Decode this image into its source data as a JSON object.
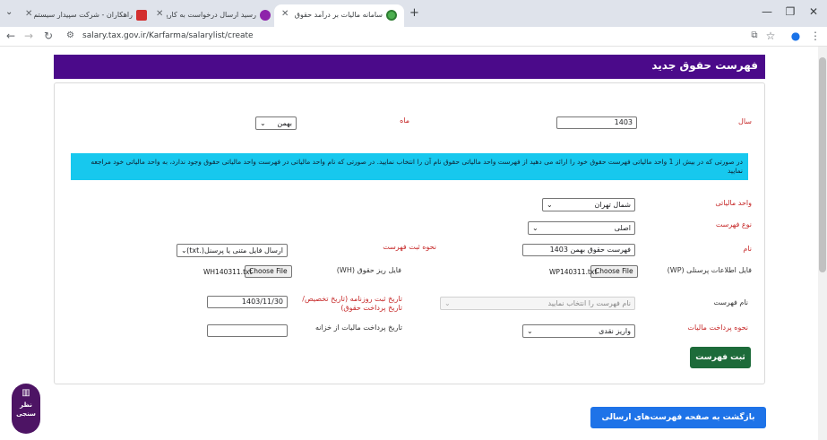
{
  "browser": {
    "tabs": [
      {
        "label": "راهکاران - شرکت سپیدار سیستم آ...",
        "active": false
      },
      {
        "label": "رسید ارسال درخواست به کارپوشه",
        "active": false
      },
      {
        "label": "سامانه مالیات بر درآمد حقوق",
        "active": true
      }
    ],
    "new_tab": "+",
    "url": "salary.tax.gov.ir/Karfarma/salarylist/create",
    "window_controls": {
      "minimize": "—",
      "restore": "❐",
      "close": "✕"
    }
  },
  "page": {
    "title": "فهرست حقوق جدید",
    "form": {
      "year_label": "سال",
      "year_value": "1403",
      "month_label": "ماه",
      "month_value": "بهمن",
      "info_text": "در صورتی که در بیش از 1 واحد مالیاتی فهرست حقوق خود را ارائه می دهید از فهرست واحد مالیاتی حقوق نام آن را انتخاب نمایید. در صورتی که نام واحد مالیاتی در فهرست واحد مالیاتی حقوق وجود ندارد، به واحد مالیاتی خود مراجعه نمایید",
      "tax_unit_label": "واحد مالیاتی",
      "tax_unit_value": "شمال تهران",
      "list_type_label": "نوع فهرست",
      "list_type_value": "اصلی",
      "name_label": "نام",
      "name_value": "فهرست حقوق بهمن 1403",
      "submit_method_label": "نحوه ثبت فهرست",
      "submit_method_value": "ارسال فایل متنی یا پرسنل(.txt)",
      "wp_file_label": "فایل اطلاعات پرسنلی (WP)",
      "wp_file_button": "Choose File",
      "wp_file_name": "WP140311.txt",
      "wh_file_label": "فایل ریز حقوق (WH)",
      "wh_file_button": "Choose File",
      "wh_file_name": "WH140311.txt",
      "list_name_label": "نام فهرست",
      "list_name_placeholder": "نام فهرست را انتخاب نمایید",
      "journal_date_label": "تاریخ ثبت روزنامه (تاریخ تخصیص/ تاریخ پرداخت حقوق)",
      "journal_date_value": "1403/11/30",
      "payment_method_label": "نحوه پرداخت مالیات",
      "payment_method_value": "واریز نقدی",
      "treasury_date_label": "تاریخ پرداخت مالیات از خزانه",
      "treasury_date_value": "",
      "submit_label": "ثبت فهرست"
    },
    "back_label": "بازگشت به صفحه فهرست‌های ارسالی",
    "feedback_label_1": "نظر",
    "feedback_label_2": "سنجی"
  },
  "colors": {
    "header": "#4b0a8a",
    "info": "#17c8ee",
    "submit": "#1d6b3a",
    "back": "#1e73e8",
    "feedback": "#4d1464",
    "label_red": "#c62828"
  }
}
